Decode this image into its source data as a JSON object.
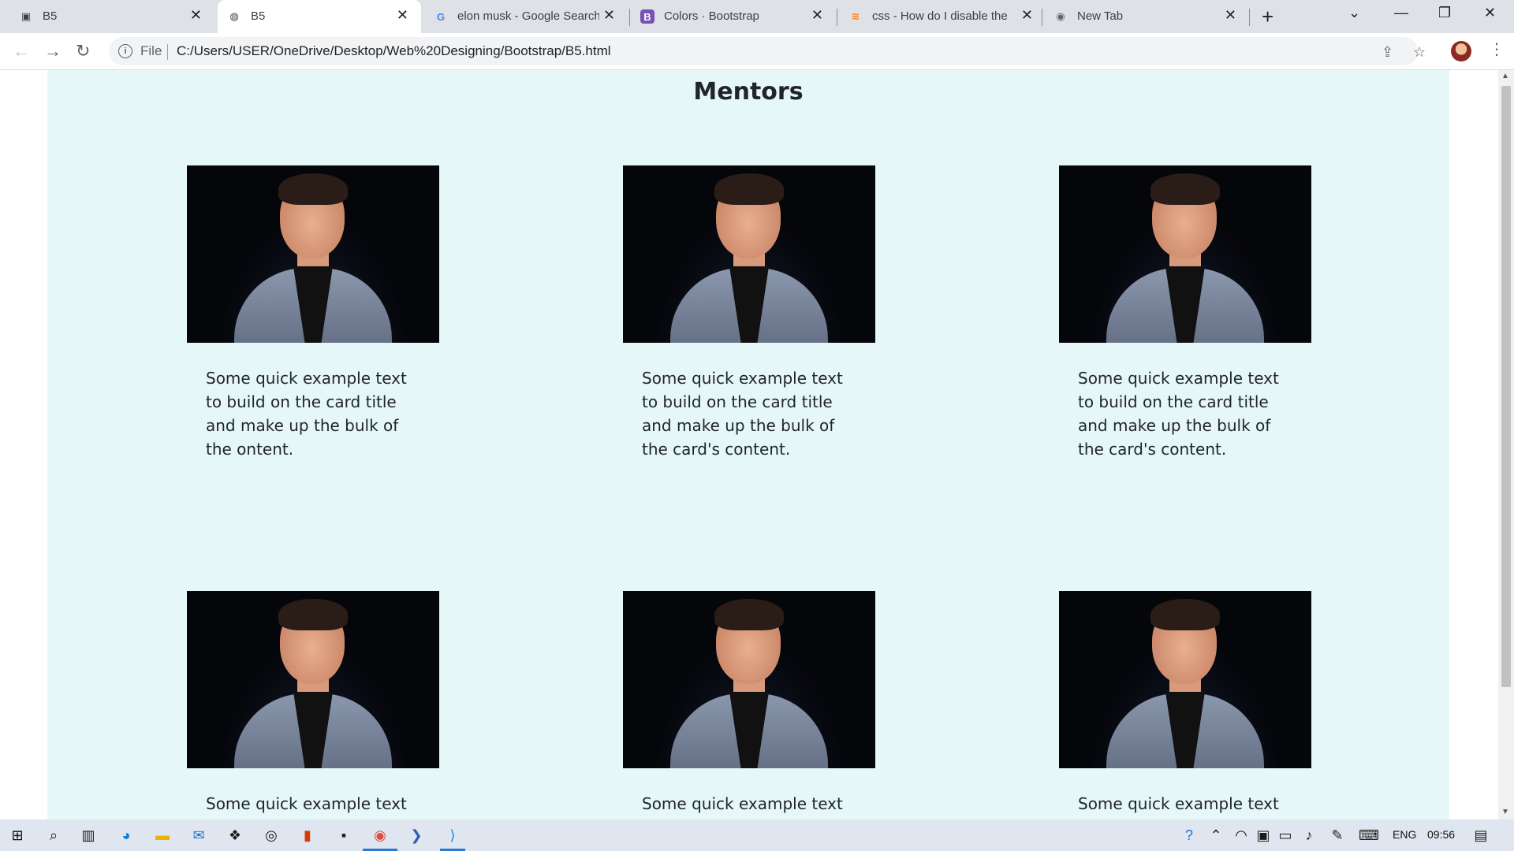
{
  "browser": {
    "tabs": [
      {
        "title": "B5",
        "icon": "contact-card-icon",
        "active": false
      },
      {
        "title": "B5",
        "icon": "globe-icon",
        "active": true
      },
      {
        "title": "elon musk - Google Search",
        "icon": "google-icon",
        "active": false
      },
      {
        "title": "Colors · Bootstrap",
        "icon": "bootstrap-icon",
        "active": false
      },
      {
        "title": "css - How do I disable the b",
        "icon": "stackoverflow-icon",
        "active": false
      },
      {
        "title": "New Tab",
        "icon": "chrome-icon",
        "active": false
      }
    ],
    "address": {
      "scheme": "File",
      "url": "C:/Users/USER/OneDrive/Desktop/Web%20Designing/Bootstrap/B5.html"
    }
  },
  "page": {
    "heading": "Mentors",
    "cards": [
      {
        "text": "Some quick example text to build on the card title and make up the bulk of the ontent."
      },
      {
        "text": "Some quick example text to build on the card title and make up the bulk of the card's content."
      },
      {
        "text": "Some quick example text to build on the card title and make up the bulk of the card's content."
      },
      {
        "text": "Some quick example text to"
      },
      {
        "text": "Some quick example text to"
      },
      {
        "text": "Some quick example text to"
      }
    ]
  },
  "taskbar": {
    "language": "ENG",
    "time": "09:56"
  },
  "colors": {
    "page_background": "#e6f7f8",
    "tabstrip": "#dee1e6",
    "taskbar": "#dfe6ef",
    "accent": "#2b78d4"
  }
}
